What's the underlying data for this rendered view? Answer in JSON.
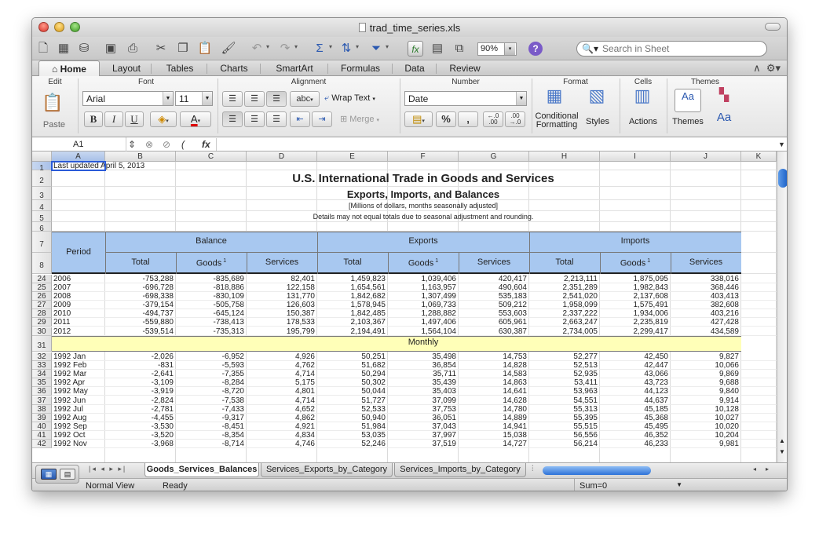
{
  "window": {
    "title": "trad_time_series.xls"
  },
  "toolbar": {
    "zoom": "90%",
    "search_placeholder": "Search in Sheet"
  },
  "ribbon_tabs": [
    "Home",
    "Layout",
    "Tables",
    "Charts",
    "SmartArt",
    "Formulas",
    "Data",
    "Review"
  ],
  "ribbon": {
    "groups": {
      "edit": "Edit",
      "font": "Font",
      "alignment": "Alignment",
      "number": "Number",
      "format": "Format",
      "cells": "Cells",
      "themes": "Themes"
    },
    "paste_label": "Paste",
    "font_name": "Arial",
    "font_size": "11",
    "bold": "B",
    "italic": "I",
    "underline": "U",
    "wrap_text": "Wrap Text",
    "merge": "Merge",
    "number_format": "Date",
    "conditional_formatting_line1": "Conditional",
    "conditional_formatting_line2": "Formatting",
    "styles": "Styles",
    "actions": "Actions",
    "themes_label": "Themes",
    "abc": "abc",
    "percent": "%",
    "comma": "ʔ",
    "dec_inc": ".0\n.00",
    "dec_dec": ".00\n.0"
  },
  "formula_bar": {
    "name_box": "A1",
    "fx": "fx"
  },
  "columns": [
    "A",
    "B",
    "C",
    "D",
    "E",
    "F",
    "G",
    "H",
    "I",
    "J",
    "K"
  ],
  "sheet": {
    "a1": "Last updated April 5, 2013",
    "title": "U.S. International Trade in Goods and Services",
    "subtitle": "Exports, Imports, and Balances",
    "units": "[Millions of dollars, months seasonally adjusted]",
    "note": "Details may not equal totals due to seasonal adjustment and rounding.",
    "period": "Period",
    "balance": "Balance",
    "exports": "Exports",
    "imports": "Imports",
    "total": "Total",
    "goods": "Goods",
    "goods_sup": "1",
    "services": "Services",
    "monthly": "Monthly"
  },
  "annual_rows": [
    {
      "row": "24",
      "period": "2006",
      "v": [
        "-753,288",
        "-835,689",
        "82,401",
        "1,459,823",
        "1,039,406",
        "420,417",
        "2,213,111",
        "1,875,095",
        "338,016"
      ]
    },
    {
      "row": "25",
      "period": "2007",
      "v": [
        "-696,728",
        "-818,886",
        "122,158",
        "1,654,561",
        "1,163,957",
        "490,604",
        "2,351,289",
        "1,982,843",
        "368,446"
      ]
    },
    {
      "row": "26",
      "period": "2008",
      "v": [
        "-698,338",
        "-830,109",
        "131,770",
        "1,842,682",
        "1,307,499",
        "535,183",
        "2,541,020",
        "2,137,608",
        "403,413"
      ]
    },
    {
      "row": "27",
      "period": "2009",
      "v": [
        "-379,154",
        "-505,758",
        "126,603",
        "1,578,945",
        "1,069,733",
        "509,212",
        "1,958,099",
        "1,575,491",
        "382,608"
      ]
    },
    {
      "row": "28",
      "period": "2010",
      "v": [
        "-494,737",
        "-645,124",
        "150,387",
        "1,842,485",
        "1,288,882",
        "553,603",
        "2,337,222",
        "1,934,006",
        "403,216"
      ]
    },
    {
      "row": "29",
      "period": "2011",
      "v": [
        "-559,880",
        "-738,413",
        "178,533",
        "2,103,367",
        "1,497,406",
        "605,961",
        "2,663,247",
        "2,235,819",
        "427,428"
      ]
    },
    {
      "row": "30",
      "period": "2012",
      "v": [
        "-539,514",
        "-735,313",
        "195,799",
        "2,194,491",
        "1,564,104",
        "630,387",
        "2,734,005",
        "2,299,417",
        "434,589"
      ]
    }
  ],
  "monthly_rows": [
    {
      "row": "32",
      "period": "1992 Jan",
      "v": [
        "-2,026",
        "-6,952",
        "4,926",
        "50,251",
        "35,498",
        "14,753",
        "52,277",
        "42,450",
        "9,827"
      ]
    },
    {
      "row": "33",
      "period": "1992 Feb",
      "v": [
        "-831",
        "-5,593",
        "4,762",
        "51,682",
        "36,854",
        "14,828",
        "52,513",
        "42,447",
        "10,066"
      ]
    },
    {
      "row": "34",
      "period": "1992 Mar",
      "v": [
        "-2,641",
        "-7,355",
        "4,714",
        "50,294",
        "35,711",
        "14,583",
        "52,935",
        "43,066",
        "9,869"
      ]
    },
    {
      "row": "35",
      "period": "1992 Apr",
      "v": [
        "-3,109",
        "-8,284",
        "5,175",
        "50,302",
        "35,439",
        "14,863",
        "53,411",
        "43,723",
        "9,688"
      ]
    },
    {
      "row": "36",
      "period": "1992 May",
      "v": [
        "-3,919",
        "-8,720",
        "4,801",
        "50,044",
        "35,403",
        "14,641",
        "53,963",
        "44,123",
        "9,840"
      ]
    },
    {
      "row": "37",
      "period": "1992 Jun",
      "v": [
        "-2,824",
        "-7,538",
        "4,714",
        "51,727",
        "37,099",
        "14,628",
        "54,551",
        "44,637",
        "9,914"
      ]
    },
    {
      "row": "38",
      "period": "1992 Jul",
      "v": [
        "-2,781",
        "-7,433",
        "4,652",
        "52,533",
        "37,753",
        "14,780",
        "55,313",
        "45,185",
        "10,128"
      ]
    },
    {
      "row": "39",
      "period": "1992 Aug",
      "v": [
        "-4,455",
        "-9,317",
        "4,862",
        "50,940",
        "36,051",
        "14,889",
        "55,395",
        "45,368",
        "10,027"
      ]
    },
    {
      "row": "40",
      "period": "1992 Sep",
      "v": [
        "-3,530",
        "-8,451",
        "4,921",
        "51,984",
        "37,043",
        "14,941",
        "55,515",
        "45,495",
        "10,020"
      ]
    },
    {
      "row": "41",
      "period": "1992 Oct",
      "v": [
        "-3,520",
        "-8,354",
        "4,834",
        "53,035",
        "37,997",
        "15,038",
        "56,556",
        "46,352",
        "10,204"
      ]
    },
    {
      "row": "42",
      "period": "1992 Nov",
      "v": [
        "-3,968",
        "-8,714",
        "4,746",
        "52,246",
        "37,519",
        "14,727",
        "56,214",
        "46,233",
        "9,981"
      ]
    }
  ],
  "header_rows": [
    "1",
    "2",
    "3",
    "4",
    "5",
    "6",
    "7",
    "8",
    "31"
  ],
  "sheet_tabs": [
    "Goods_Services_Balances",
    "Services_Exports_by_Category",
    "Services_Imports_by_Category"
  ],
  "status": {
    "view": "Normal View",
    "state": "Ready",
    "sum": "Sum=0"
  },
  "colors": {
    "header_blue": "#a8c8f0",
    "monthly_yellow": "#ffffb8",
    "selection": "#2a5ad8"
  }
}
